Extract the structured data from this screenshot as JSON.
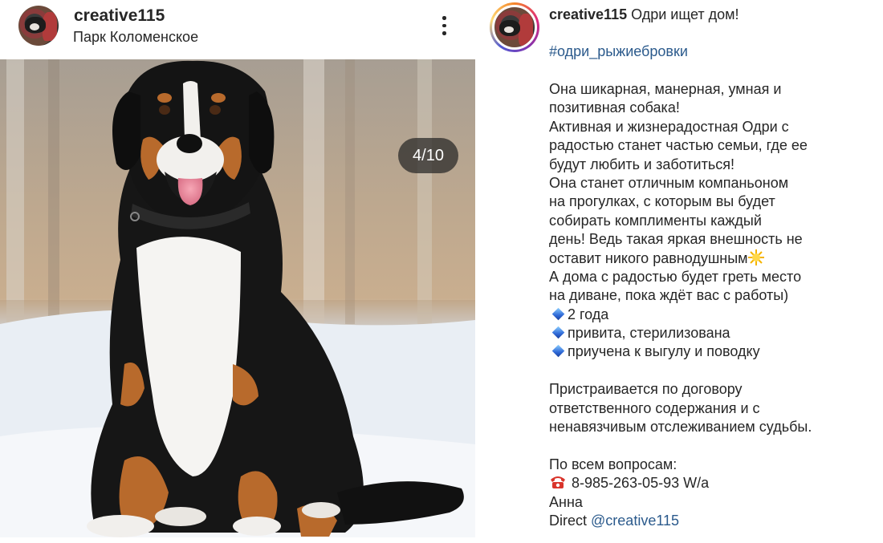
{
  "post": {
    "username": "creative115",
    "location": "Парк Коломенское",
    "photo_counter": "4/10",
    "icons": {
      "more": "more-vertical-icon"
    }
  },
  "caption": {
    "username": "creative115",
    "headline": "Одри ищет дом!",
    "hashtag": "#одри_рыжиебровки",
    "lines": [
      "Она шикарная, манерная, умная и",
      "позитивная собака!",
      "Активная и жизнерадостная Одри с",
      "радостью станет частью семьи, где ее",
      "будут любить и заботиться!",
      "Она станет отличным компаньоном",
      "на прогулках, с которым вы будет",
      "собирать комплименты каждый",
      "день! Ведь такая яркая внешность не",
      "оставит никого равнодушным",
      "А дома с радостью будет греть место",
      "на диване, пока ждёт вас с работы)"
    ],
    "facts": [
      "2 года",
      "привита, стерилизована",
      "приучена к выгулу и поводку"
    ],
    "adoption_lines": [
      "Пристраивается по договору",
      "ответственного содержания и с",
      "ненавязчивым отслеживанием судьбы."
    ],
    "contact_header": "По всем вопросам:",
    "phone": "8-985-263-05-93 W/a",
    "contact_name": "Анна",
    "direct_label": "Direct",
    "direct_handle": "@creative115"
  },
  "colors": {
    "link": "#2b5a8c",
    "text": "#262626",
    "badge_bg": "rgba(38,38,38,0.72)"
  }
}
